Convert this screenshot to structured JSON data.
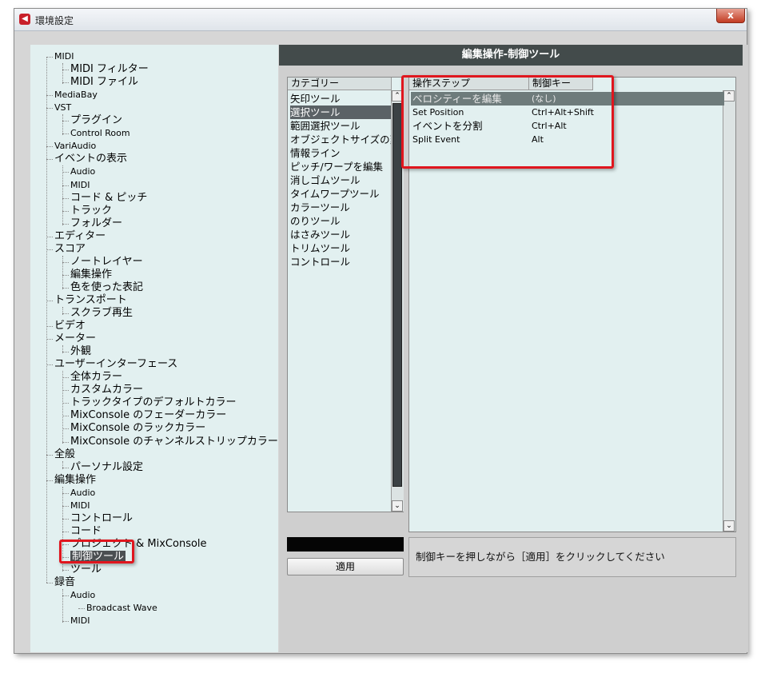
{
  "window": {
    "title": "環境設定",
    "close_label": "x"
  },
  "tree": {
    "items": [
      {
        "label": "MIDI",
        "level": 1
      },
      {
        "label": "MIDI フィルター",
        "level": 2
      },
      {
        "label": "MIDI ファイル",
        "level": 2
      },
      {
        "label": "MediaBay",
        "level": 1
      },
      {
        "label": "VST",
        "level": 1
      },
      {
        "label": "プラグイン",
        "level": 2
      },
      {
        "label": "Control Room",
        "level": 2
      },
      {
        "label": "VariAudio",
        "level": 1
      },
      {
        "label": "イベントの表示",
        "level": 1
      },
      {
        "label": "Audio",
        "level": 2
      },
      {
        "label": "MIDI",
        "level": 2
      },
      {
        "label": "コード & ピッチ",
        "level": 2
      },
      {
        "label": "トラック",
        "level": 2
      },
      {
        "label": "フォルダー",
        "level": 2
      },
      {
        "label": "エディター",
        "level": 1
      },
      {
        "label": "スコア",
        "level": 1
      },
      {
        "label": "ノートレイヤー",
        "level": 2
      },
      {
        "label": "編集操作",
        "level": 2
      },
      {
        "label": "色を使った表記",
        "level": 2
      },
      {
        "label": "トランスポート",
        "level": 1
      },
      {
        "label": "スクラブ再生",
        "level": 2
      },
      {
        "label": "ビデオ",
        "level": 1
      },
      {
        "label": "メーター",
        "level": 1
      },
      {
        "label": "外観",
        "level": 2
      },
      {
        "label": "ユーザーインターフェース",
        "level": 1
      },
      {
        "label": "全体カラー",
        "level": 2
      },
      {
        "label": "カスタムカラー",
        "level": 2
      },
      {
        "label": "トラックタイプのデフォルトカラー",
        "level": 2
      },
      {
        "label": "MixConsole のフェーダーカラー",
        "level": 2
      },
      {
        "label": "MixConsole のラックカラー",
        "level": 2
      },
      {
        "label": "MixConsole のチャンネルストリップカラー",
        "level": 2
      },
      {
        "label": "全般",
        "level": 1
      },
      {
        "label": "パーソナル設定",
        "level": 2
      },
      {
        "label": "編集操作",
        "level": 1
      },
      {
        "label": "Audio",
        "level": 2
      },
      {
        "label": "MIDI",
        "level": 2
      },
      {
        "label": "コントロール",
        "level": 2
      },
      {
        "label": "コード",
        "level": 2
      },
      {
        "label": "プロジェクト & MixConsole",
        "level": 2
      },
      {
        "label": "制御ツール",
        "level": 2,
        "selected": true
      },
      {
        "label": "ツール",
        "level": 2
      },
      {
        "label": "録音",
        "level": 1
      },
      {
        "label": "Audio",
        "level": 2
      },
      {
        "label": "Broadcast Wave",
        "level": 3
      },
      {
        "label": "MIDI",
        "level": 2
      }
    ]
  },
  "header": {
    "title": "編集操作-制御ツール"
  },
  "categories": {
    "header": "カテゴリー",
    "items": [
      "矢印ツール",
      "選択ツール",
      "範囲選択ツール",
      "オブジェクトサイズの変",
      "情報ライン",
      "ピッチ/ワープを編集",
      "消しゴムツール",
      "タイムワープツール",
      "カラーツール",
      "のりツール",
      "はさみツール",
      "トリムツール",
      "コントロール"
    ],
    "selected_index": 1
  },
  "actions": {
    "col_step": "操作ステップ",
    "col_key": "制御キー",
    "rows": [
      {
        "step": "ベロシティーを編集",
        "key": "(なし)"
      },
      {
        "step": "Set Position",
        "key": "Ctrl+Alt+Shift"
      },
      {
        "step": "イベントを分割",
        "key": "Ctrl+Alt"
      },
      {
        "step": "Split Event",
        "key": "Alt"
      }
    ],
    "selected_index": 0
  },
  "apply_button": "適用",
  "hint": "制御キーを押しながら［適用］をクリックしてください",
  "colors": {
    "highlight_red": "#e0161e",
    "header_bg": "#434b4b",
    "panel_bg": "#e2f0f0"
  }
}
